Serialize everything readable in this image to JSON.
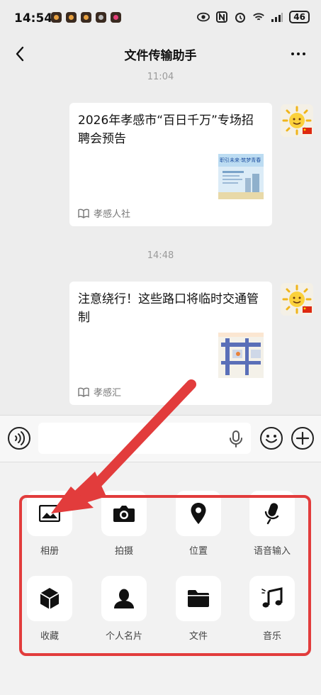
{
  "status_bar": {
    "time": "14:54",
    "battery": "46"
  },
  "header": {
    "title": "文件传输助手"
  },
  "messages": [
    {
      "time": "11:04",
      "title": "2026年孝感市“百日千万”专场招聘会预告",
      "source": "孝感人社",
      "thumb_caption": "职引未来·筑梦青春"
    },
    {
      "time": "14:48",
      "title": "注意绕行！这些路口将临时交通管制",
      "source": "孝感汇"
    }
  ],
  "panel": {
    "items": [
      {
        "label": "相册",
        "icon": "album-icon"
      },
      {
        "label": "拍摄",
        "icon": "camera-icon"
      },
      {
        "label": "位置",
        "icon": "location-icon"
      },
      {
        "label": "语音输入",
        "icon": "voice-input-icon"
      },
      {
        "label": "收藏",
        "icon": "favorites-icon"
      },
      {
        "label": "个人名片",
        "icon": "contact-card-icon"
      },
      {
        "label": "文件",
        "icon": "folder-icon"
      },
      {
        "label": "音乐",
        "icon": "music-icon"
      }
    ]
  },
  "colors": {
    "highlight": "#e23c3c",
    "background": "#ededed"
  }
}
